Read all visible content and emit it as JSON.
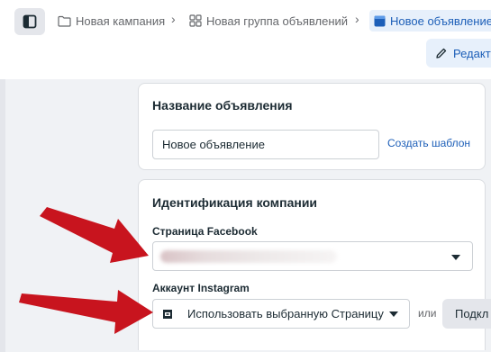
{
  "breadcrumb": {
    "campaign": "Новая кампания",
    "ad_set": "Новая группа объявлений",
    "ad": "Новое объявление"
  },
  "toolbar": {
    "edit_label": "Редакт"
  },
  "ad_name_section": {
    "title": "Название объявления",
    "name_value": "Новое объявление",
    "create_template_label": "Создать шаблон"
  },
  "identity_section": {
    "title": "Идентификация компании",
    "facebook_page_label": "Страница Facebook",
    "instagram_label": "Аккаунт Instagram",
    "instagram_value": "Использовать выбранную Страницу",
    "or_text": "или",
    "connect_label": "Подкл"
  },
  "colors": {
    "accent": "#1d5fb8",
    "annotation_arrow": "#c8141e"
  }
}
